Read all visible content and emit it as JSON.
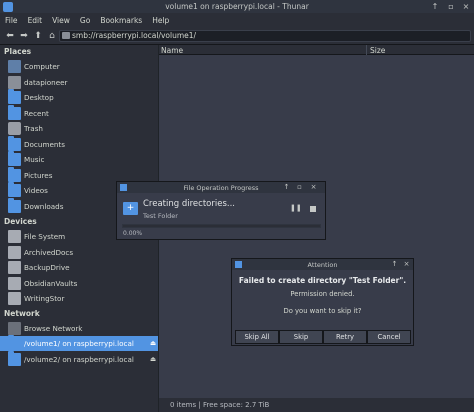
{
  "window": {
    "title": "volume1 on raspberrypi.local - Thunar"
  },
  "menu": [
    "File",
    "Edit",
    "View",
    "Go",
    "Bookmarks",
    "Help"
  ],
  "location": {
    "path": "smb://raspberrypi.local/volume1/"
  },
  "columns": {
    "name": "Name",
    "size": "Size"
  },
  "sidebar": {
    "places_label": "Places",
    "places": [
      {
        "label": "Computer",
        "icon": "computer-icon"
      },
      {
        "label": "datapioneer",
        "icon": "home-icon"
      },
      {
        "label": "Desktop",
        "icon": "folder-icon"
      },
      {
        "label": "Recent",
        "icon": "folder-icon"
      },
      {
        "label": "Trash",
        "icon": "trash-icon"
      },
      {
        "label": "Documents",
        "icon": "folder-icon"
      },
      {
        "label": "Music",
        "icon": "folder-icon"
      },
      {
        "label": "Pictures",
        "icon": "folder-icon"
      },
      {
        "label": "Videos",
        "icon": "folder-icon"
      },
      {
        "label": "Downloads",
        "icon": "folder-icon"
      }
    ],
    "devices_label": "Devices",
    "devices": [
      {
        "label": "File System",
        "icon": "drive-icon"
      },
      {
        "label": "ArchivedDocs",
        "icon": "drive-icon"
      },
      {
        "label": "BackupDrive",
        "icon": "drive-icon"
      },
      {
        "label": "ObsidianVaults",
        "icon": "drive-icon"
      },
      {
        "label": "WritingStor",
        "icon": "drive-icon"
      }
    ],
    "network_label": "Network",
    "network": [
      {
        "label": "Browse Network",
        "icon": "network-icon"
      },
      {
        "label": "/volume1/ on raspberrypi.local",
        "icon": "network-folder-icon",
        "selected": true
      },
      {
        "label": "/volume2/ on raspberrypi.local",
        "icon": "network-folder-icon"
      }
    ]
  },
  "status": {
    "text": "0 items  |  Free space: 2.7 TiB"
  },
  "progress_dialog": {
    "title": "File Operation Progress",
    "heading": "Creating directories...",
    "item": "Test Folder",
    "percent_text": "0.00%",
    "progress": 0.0
  },
  "attention_dialog": {
    "title": "Attention",
    "heading": "Failed to create directory \"Test Folder\".",
    "message": "Permission denied.",
    "question": "Do you want to skip it?",
    "buttons": [
      "Skip All",
      "Skip",
      "Retry",
      "Cancel"
    ]
  },
  "colors": {
    "accent": "#5294e2",
    "background": "#383c4a",
    "sidebar": "#2b2e37"
  }
}
